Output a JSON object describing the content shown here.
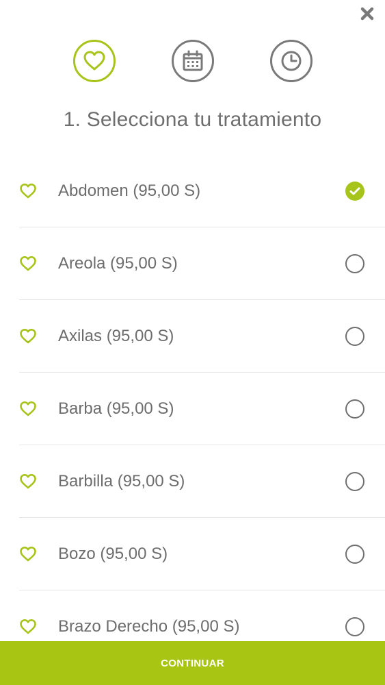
{
  "title": "1. Selecciona tu tratamiento",
  "colors": {
    "accent": "#a7c41a",
    "inactive": "#7a7a7a",
    "button": "#a9c514"
  },
  "steps": [
    {
      "icon": "heart-icon",
      "active": true
    },
    {
      "icon": "calendar-icon",
      "active": false
    },
    {
      "icon": "clock-icon",
      "active": false
    }
  ],
  "treatments": [
    {
      "label": "Abdomen (95,00 S)",
      "selected": true
    },
    {
      "label": "Areola (95,00 S)",
      "selected": false
    },
    {
      "label": "Axilas (95,00 S)",
      "selected": false
    },
    {
      "label": "Barba (95,00 S)",
      "selected": false
    },
    {
      "label": "Barbilla (95,00 S)",
      "selected": false
    },
    {
      "label": "Bozo (95,00 S)",
      "selected": false
    },
    {
      "label": "Brazo Derecho (95,00 S)",
      "selected": false
    }
  ],
  "continue_label": "CONTINUAR"
}
